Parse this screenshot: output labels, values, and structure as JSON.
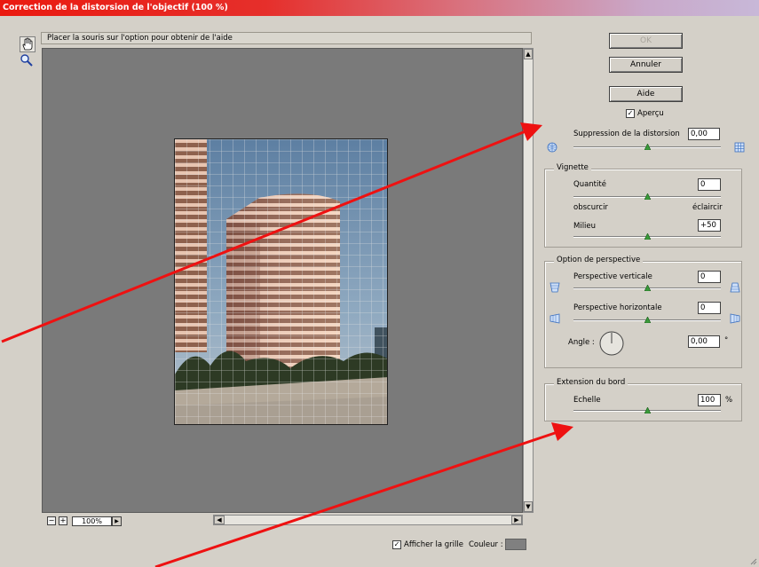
{
  "window": {
    "title": "Correction de la distorsion de l'objectif (100 %)"
  },
  "toolbar": {
    "hand_tool_icon": "hand-icon",
    "zoom_tool_icon": "zoom-icon"
  },
  "helpbar": {
    "text": "Placer la souris sur l'option pour obtenir de l'aide"
  },
  "preview": {
    "zoom_value": "100%",
    "zoom_out_label": "−",
    "zoom_in_label": "+"
  },
  "buttons": {
    "ok": "OK",
    "cancel": "Annuler",
    "help": "Aide"
  },
  "apercu": {
    "label": "Aperçu",
    "checked": true
  },
  "distortion": {
    "label": "Suppression de la distorsion",
    "value": "0,00",
    "slider_fraction": 0.5
  },
  "vignette": {
    "title": "Vignette",
    "quantity_label": "Quantité",
    "quantity_value": "0",
    "quantity_fraction": 0.5,
    "darken_label": "obscurcir",
    "lighten_label": "éclaircir",
    "midpoint_label": "Milieu",
    "midpoint_value": "+50",
    "midpoint_fraction": 0.5
  },
  "perspective": {
    "title": "Option de perspective",
    "vertical_label": "Perspective verticale",
    "vertical_value": "0",
    "vertical_fraction": 0.5,
    "horizontal_label": "Perspective horizontale",
    "horizontal_value": "0",
    "horizontal_fraction": 0.5,
    "angle_label": "Angle :",
    "angle_value": "0,00",
    "angle_unit": "°"
  },
  "edge": {
    "title": "Extension du bord",
    "scale_label": "Echelle",
    "scale_value": "100",
    "scale_unit": "%",
    "scale_fraction": 0.5
  },
  "grid": {
    "show_label": "Afficher la grille",
    "checked": true,
    "color_label": "Couleur :",
    "color": "#808080"
  },
  "colors": {
    "annotation_arrow": "#ee1111",
    "title_bar_start": "#ea1a10"
  }
}
